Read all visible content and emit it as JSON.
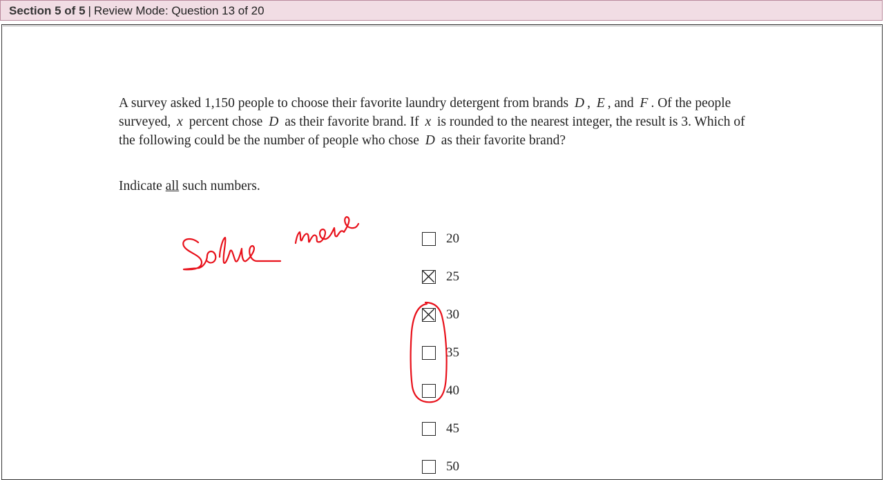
{
  "header": {
    "section": "Section 5 of 5",
    "separator": "|",
    "mode": "Review Mode: Question 13 of 20"
  },
  "question": {
    "p1": "A survey asked ",
    "count": "1,150",
    "p2": " people to choose their favorite laundry detergent from brands",
    "brand_d": "D",
    "comma1": ",",
    "brand_e": "E",
    "p3": ", and",
    "brand_f": "F",
    "p4": ". Of the people surveyed,",
    "var_x": "x",
    "p5": "percent chose",
    "brand_d2": "D",
    "p6": "as their favorite brand. If",
    "var_x2": "x",
    "p7": "is rounded to the nearest integer, the result is 3. Which of the following could be the number of people who chose",
    "brand_d3": "D",
    "p8": "as their favorite brand?"
  },
  "instruction": {
    "before": "Indicate ",
    "underlined": "all",
    "after": " such numbers."
  },
  "options": [
    {
      "label": "20",
      "checked": false
    },
    {
      "label": "25",
      "checked": true
    },
    {
      "label": "30",
      "checked": true
    },
    {
      "label": "35",
      "checked": false
    },
    {
      "label": "40",
      "checked": false
    },
    {
      "label": "45",
      "checked": false
    },
    {
      "label": "50",
      "checked": false
    }
  ],
  "annotation": {
    "handwriting": "Solve more",
    "ink_color": "#e8101a"
  }
}
